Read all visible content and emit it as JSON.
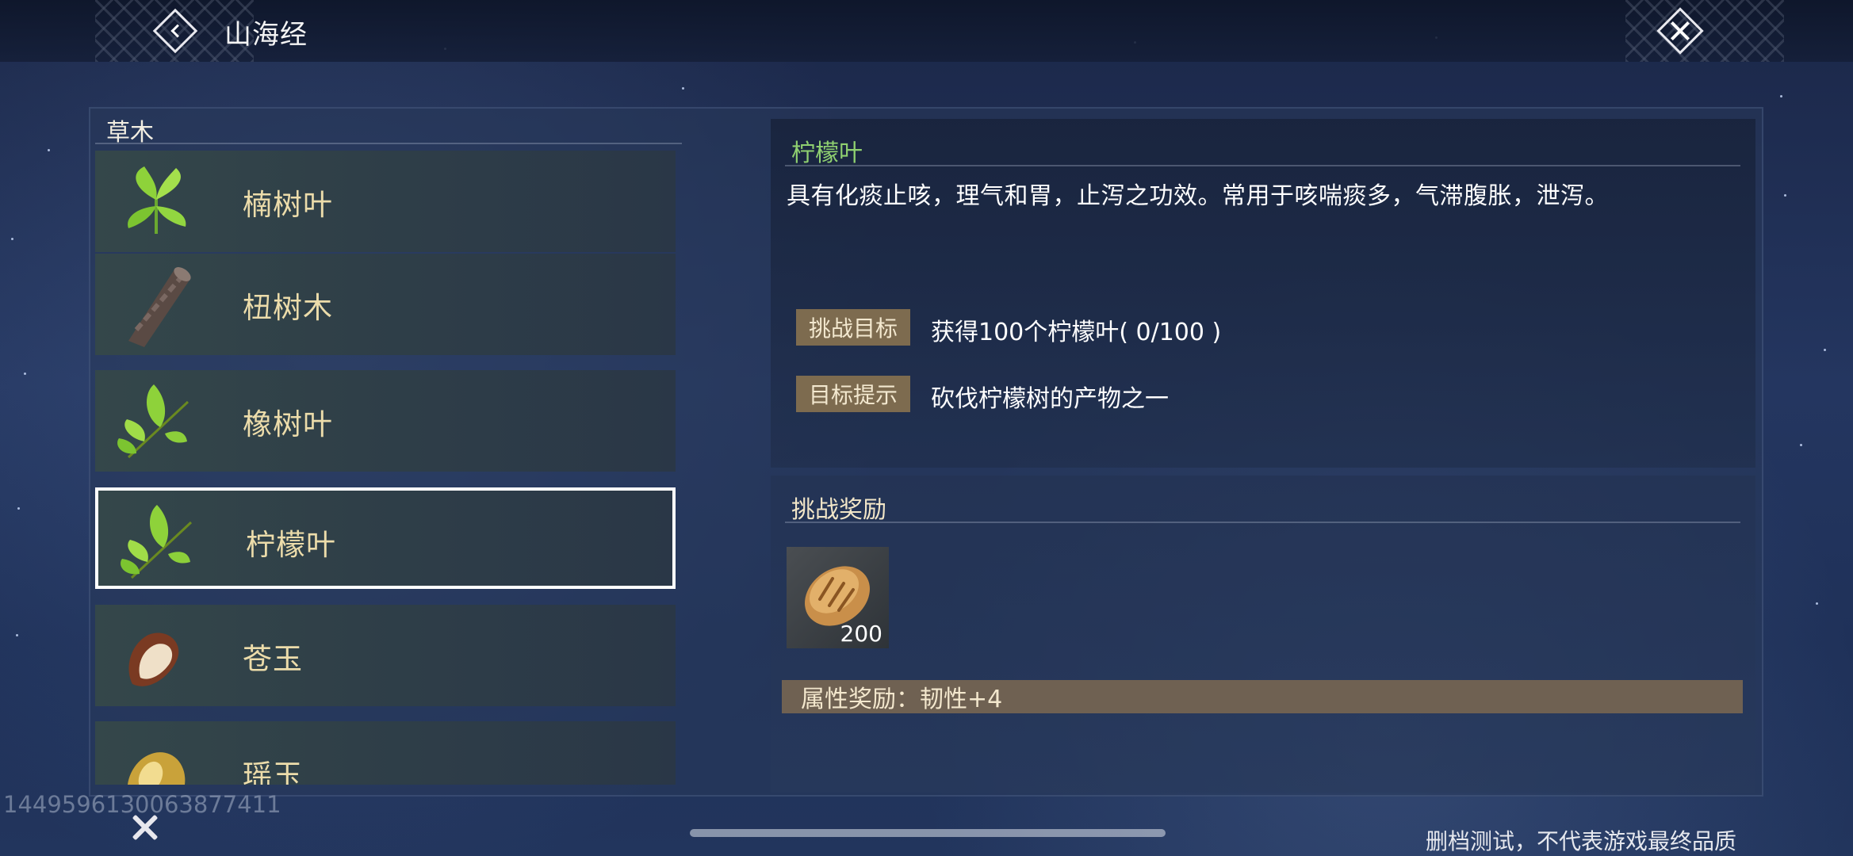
{
  "header": {
    "title": "山海经",
    "back_icon": "chevron-left-icon",
    "close_icon": "close-icon"
  },
  "category": "草木",
  "items": [
    {
      "label": "楠树叶",
      "icon": "leaf-icon"
    },
    {
      "label": "杻树木",
      "icon": "log-icon"
    },
    {
      "label": "橡树叶",
      "icon": "leaf-sprig-icon"
    },
    {
      "label": "柠檬叶",
      "icon": "leaf-sprig-icon",
      "selected": true
    },
    {
      "label": "苍玉",
      "icon": "stone-icon"
    },
    {
      "label": "瑶玉",
      "icon": "jade-icon"
    }
  ],
  "detail": {
    "name": "柠檬叶",
    "description": "具有化痰止咳，理气和胃，止泻之功效。常用于咳喘痰多，气滞腹胀，泄泻。",
    "goal_label": "挑战目标",
    "goal_value": "获得100个柠檬叶( 0/100 )",
    "hint_label": "目标提示",
    "hint_value": "砍伐柠檬树的产物之一"
  },
  "reward": {
    "title": "挑战奖励",
    "item_icon": "bread-icon",
    "item_count": "200",
    "attribute": "属性奖励：韧性+4"
  },
  "footer": {
    "watermark": "1449596130063877411",
    "disclaimer": "删档测试，不代表游戏最终品质"
  },
  "colors": {
    "item_label": "#ecdcaa",
    "detail_name": "#8fd070",
    "tag_bg": "#7d6b4f"
  }
}
